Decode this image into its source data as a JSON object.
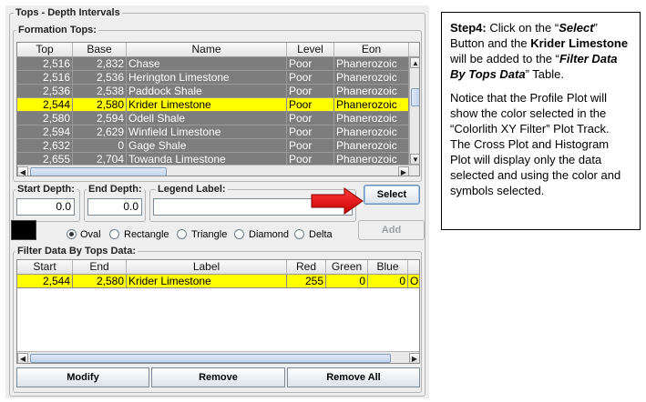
{
  "panel": {
    "title": "Tops - Depth Intervals",
    "formation_group_title": "Formation Tops:",
    "formation_table": {
      "columns": [
        "Top",
        "Base",
        "Name",
        "Level",
        "Eon"
      ],
      "rows": [
        [
          "2,516",
          "2,832",
          "Chase",
          "Poor",
          "Phanerozoic"
        ],
        [
          "2,516",
          "2,536",
          "Herington Limestone",
          "Poor",
          "Phanerozoic"
        ],
        [
          "2,536",
          "2,538",
          "Paddock Shale",
          "Poor",
          "Phanerozoic"
        ],
        [
          "2,544",
          "2,580",
          "Krider Limestone",
          "Poor",
          "Phanerozoic"
        ],
        [
          "2,580",
          "2,594",
          "Odell Shale",
          "Poor",
          "Phanerozoic"
        ],
        [
          "2,594",
          "2,629",
          "Winfield Limestone",
          "Poor",
          "Phanerozoic"
        ],
        [
          "2,632",
          "0",
          "Gage Shale",
          "Poor",
          "Phanerozoic"
        ],
        [
          "2,655",
          "2,704",
          "Towanda Limestone",
          "Poor",
          "Phanerozoic"
        ]
      ],
      "selected_row": 3
    },
    "start_depth": {
      "label": "Start Depth:",
      "value": "0.0"
    },
    "end_depth": {
      "label": "End Depth:",
      "value": "0.0"
    },
    "legend_label": {
      "label": "Legend Label:",
      "value": ""
    },
    "select_button": "Select",
    "add_button": "Add",
    "color_swatch": "#000000",
    "symbols": [
      {
        "label": "Oval",
        "checked": true
      },
      {
        "label": "Rectangle",
        "checked": false
      },
      {
        "label": "Triangle",
        "checked": false
      },
      {
        "label": "Diamond",
        "checked": false
      },
      {
        "label": "Delta",
        "checked": false
      }
    ],
    "filter_group_title": "Filter Data By Tops Data:",
    "filter_table": {
      "columns": [
        "Start",
        "End",
        "Label",
        "Red",
        "Green",
        "Blue"
      ],
      "rows": [
        [
          "2,544",
          "2,580",
          "Krider Limestone",
          "255",
          "0",
          "0",
          "O"
        ]
      ]
    },
    "modify_button": "Modify",
    "remove_button": "Remove",
    "remove_all_button": "Remove All"
  },
  "note": {
    "step_label": "Step4:",
    "p1_a": " Click on the “",
    "p1_select": "Select",
    "p1_b": "” Button and the ",
    "p1_krider": "Krider Limestone",
    "p1_c": " will be added to the “",
    "p1_filter": "Filter Data By Tops Data",
    "p1_d": "” Table.",
    "p2": "Notice that the Profile Plot will show the color selected in the “Colorlith XY Filter” Plot Track. The Cross Plot and Histogram Plot will display only the data selected and using the color and symbols selected."
  },
  "colors": {
    "selected_row": "#ffff00",
    "unselected_row": "#7d7d7d",
    "arrow": "#e00000"
  }
}
